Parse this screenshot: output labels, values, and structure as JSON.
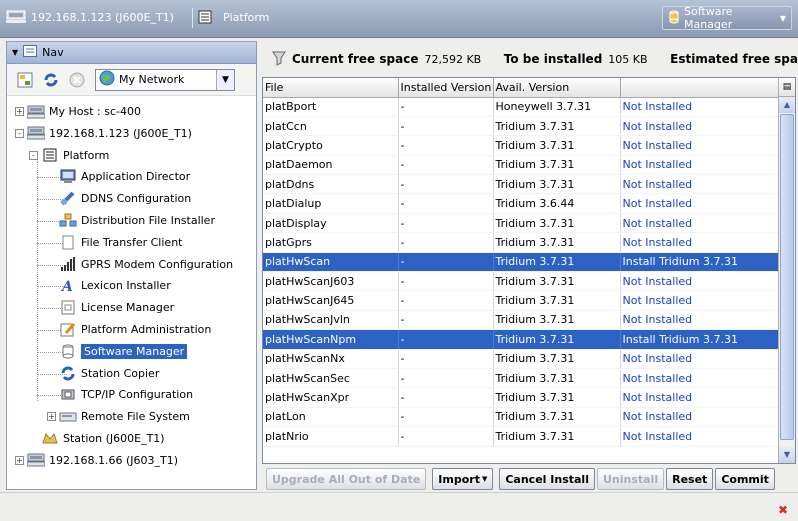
{
  "topbar": {
    "host": "192.168.1.123 (J600E_T1)",
    "platform": "Platform",
    "view_menu": "Software Manager"
  },
  "nav": {
    "header": "Nav",
    "network_select": "My Network",
    "tree": [
      {
        "label": "My Host : sc-400",
        "icon": "host-icon",
        "depth": 0,
        "expander": "+"
      },
      {
        "label": "192.168.1.123 (J600E_T1)",
        "icon": "host-icon",
        "depth": 0,
        "expander": "-"
      },
      {
        "label": "Platform",
        "icon": "platform-icon",
        "depth": 1,
        "expander": "-"
      },
      {
        "label": "Application Director",
        "icon": "monitor-icon",
        "depth": 2
      },
      {
        "label": "DDNS Configuration",
        "icon": "satellite-icon",
        "depth": 2
      },
      {
        "label": "Distribution File Installer",
        "icon": "distribution-icon",
        "depth": 2
      },
      {
        "label": "File Transfer Client",
        "icon": "file-icon",
        "depth": 2
      },
      {
        "label": "GPRS Modem Configuration",
        "icon": "signal-icon",
        "depth": 2
      },
      {
        "label": "Lexicon Installer",
        "icon": "lexicon-icon",
        "depth": 2
      },
      {
        "label": "License Manager",
        "icon": "license-icon",
        "depth": 2
      },
      {
        "label": "Platform Administration",
        "icon": "admin-icon",
        "depth": 2
      },
      {
        "label": "Software Manager",
        "icon": "software-icon",
        "depth": 2,
        "selected": true
      },
      {
        "label": "Station Copier",
        "icon": "copier-icon",
        "depth": 2
      },
      {
        "label": "TCP/IP Configuration",
        "icon": "network-card-icon",
        "depth": 2
      },
      {
        "label": "Remote File System",
        "icon": "drive-icon",
        "depth": 2,
        "expander": "+"
      },
      {
        "label": "Station (J600E_T1)",
        "icon": "station-icon",
        "depth": 1
      },
      {
        "label": "192.168.1.66 (J603_T1)",
        "icon": "host-icon",
        "depth": 0,
        "expander": "+"
      }
    ]
  },
  "space": {
    "current_label": "Current free space",
    "current_value": "72,592 KB",
    "install_label": "To be installed",
    "install_value": "105 KB",
    "estimated_label": "Estimated free spa"
  },
  "table": {
    "columns": [
      "File",
      "Installed Version",
      "Avail. Version",
      ""
    ],
    "rows": [
      {
        "file": "platBport",
        "installed": "-",
        "avail": "Honeywell 3.7.31",
        "status": "Not Installed"
      },
      {
        "file": "platCcn",
        "installed": "-",
        "avail": "Tridium 3.7.31",
        "status": "Not Installed"
      },
      {
        "file": "platCrypto",
        "installed": "-",
        "avail": "Tridium 3.7.31",
        "status": "Not Installed"
      },
      {
        "file": "platDaemon",
        "installed": "-",
        "avail": "Tridium 3.7.31",
        "status": "Not Installed"
      },
      {
        "file": "platDdns",
        "installed": "-",
        "avail": "Tridium 3.7.31",
        "status": "Not Installed"
      },
      {
        "file": "platDialup",
        "installed": "-",
        "avail": "Tridium 3.6.44",
        "status": "Not Installed"
      },
      {
        "file": "platDisplay",
        "installed": "-",
        "avail": "Tridium 3.7.31",
        "status": "Not Installed"
      },
      {
        "file": "platGprs",
        "installed": "-",
        "avail": "Tridium 3.7.31",
        "status": "Not Installed"
      },
      {
        "file": "platHwScan",
        "installed": "-",
        "avail": "Tridium 3.7.31",
        "status": "Install Tridium 3.7.31",
        "selected": true
      },
      {
        "file": "platHwScanJ603",
        "installed": "-",
        "avail": "Tridium 3.7.31",
        "status": "Not Installed"
      },
      {
        "file": "platHwScanJ645",
        "installed": "-",
        "avail": "Tridium 3.7.31",
        "status": "Not Installed"
      },
      {
        "file": "platHwScanJvln",
        "installed": "-",
        "avail": "Tridium 3.7.31",
        "status": "Not Installed"
      },
      {
        "file": "platHwScanNpm",
        "installed": "-",
        "avail": "Tridium 3.7.31",
        "status": "Install Tridium 3.7.31",
        "selected": true
      },
      {
        "file": "platHwScanNx",
        "installed": "-",
        "avail": "Tridium 3.7.31",
        "status": "Not Installed"
      },
      {
        "file": "platHwScanSec",
        "installed": "-",
        "avail": "Tridium 3.7.31",
        "status": "Not Installed"
      },
      {
        "file": "platHwScanXpr",
        "installed": "-",
        "avail": "Tridium 3.7.31",
        "status": "Not Installed"
      },
      {
        "file": "platLon",
        "installed": "-",
        "avail": "Tridium 3.7.31",
        "status": "Not Installed"
      },
      {
        "file": "platNrio",
        "installed": "-",
        "avail": "Tridium 3.7.31",
        "status": "Not Installed"
      }
    ]
  },
  "buttons": {
    "upgrade_all": "Upgrade All Out of Date",
    "import": "Import",
    "cancel_install": "Cancel Install",
    "uninstall": "Uninstall",
    "reset": "Reset",
    "commit": "Commit"
  },
  "colors": {
    "selection": "#2d62c5",
    "status_text": "#1a3ec8",
    "topbar": "#8c9ab2"
  }
}
